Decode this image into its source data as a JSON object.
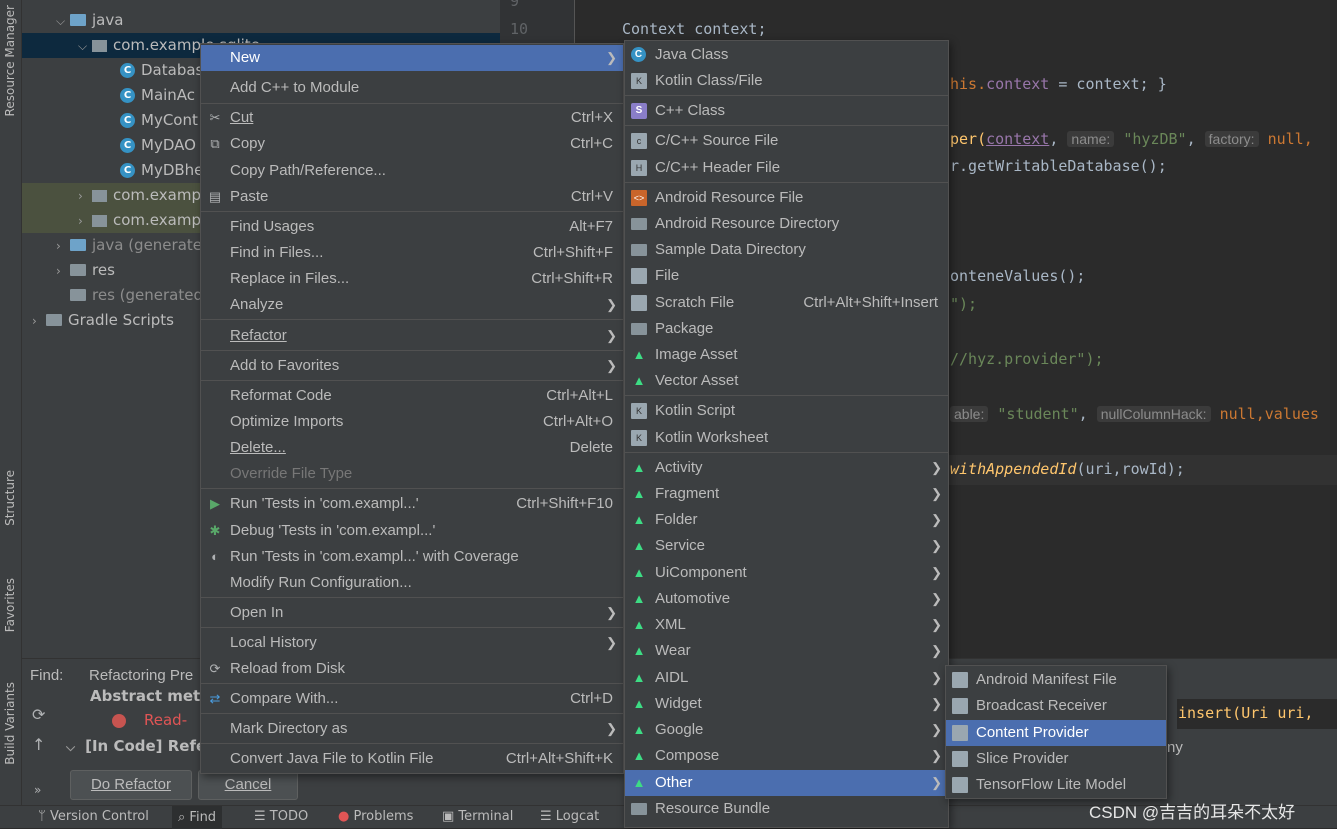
{
  "sidebar": {
    "resource_manager": "Resource Manager",
    "structure": "Structure",
    "favorites": "Favorites",
    "build_variants": "Build Variants"
  },
  "tree": {
    "java": "java",
    "pkg_main": "com.example.sqlite",
    "classes": [
      "Databas",
      "MainAc",
      "MyCont",
      "MyDAO",
      "MyDBhe"
    ],
    "pkg_androidtest": "com.examp",
    "pkg_test": "com.examp",
    "java_generated": "java (generated)",
    "res": "res",
    "res_generated": "res (generated)",
    "gradle_scripts": "Gradle Scripts"
  },
  "gutter": {
    "line9": "9",
    "line10": "10"
  },
  "code": {
    "l1": "Context context;",
    "l2a": "his.",
    "l2b": "context",
    "l2c": " = context; }",
    "l3a": "per(",
    "l3b": "context",
    "l3c": ",",
    "l3hint1": "name:",
    "l3str": "\"hyzDB\"",
    "l3hint2": "factory:",
    "l3d": "null,",
    "l4": "r.getWritableDatabase();",
    "l5": "onteneValues();",
    "l6": "\");",
    "l7": "//hyz.provider\");",
    "l8hint1": "able:",
    "l8str": "\"student\"",
    "l8hint2": "nullColumnHack:",
    "l8d": "null,values",
    "l9a": "withAppendedId",
    "l9b": "(uri,rowId);",
    "find_code": "insert(Uri uri,",
    "find_code2": "ny"
  },
  "find": {
    "label": "Find:",
    "tab": "Refactoring Pre",
    "row1": "Abstract metho",
    "row2": "Read-",
    "row3": "[In Code] Refe",
    "do_refactor": "Do Refactor",
    "cancel": "Cancel"
  },
  "bottom_bar": {
    "version_control": "Version Control",
    "find": "Find",
    "todo": "TODO",
    "problems": "Problems",
    "terminal": "Terminal",
    "logcat": "Logcat"
  },
  "context_menu": {
    "new": "New",
    "add_cpp": "Add C++ to Module",
    "cut": "Cut",
    "cut_sc": "Ctrl+X",
    "copy": "Copy",
    "copy_sc": "Ctrl+C",
    "copy_path": "Copy Path/Reference...",
    "paste": "Paste",
    "paste_sc": "Ctrl+V",
    "find_usages": "Find Usages",
    "find_usages_sc": "Alt+F7",
    "find_in_files": "Find in Files...",
    "find_in_files_sc": "Ctrl+Shift+F",
    "replace_in_files": "Replace in Files...",
    "replace_in_files_sc": "Ctrl+Shift+R",
    "analyze": "Analyze",
    "refactor": "Refactor",
    "add_to_favorites": "Add to Favorites",
    "reformat": "Reformat Code",
    "reformat_sc": "Ctrl+Alt+L",
    "optimize": "Optimize Imports",
    "optimize_sc": "Ctrl+Alt+O",
    "delete": "Delete...",
    "delete_sc": "Delete",
    "override": "Override File Type",
    "run": "Run 'Tests in 'com.exampl...'",
    "run_sc": "Ctrl+Shift+F10",
    "debug": "Debug 'Tests in 'com.exampl...'",
    "coverage": "Run 'Tests in 'com.exampl...' with Coverage",
    "modify_run": "Modify Run Configuration...",
    "open_in": "Open In",
    "local_history": "Local History",
    "reload": "Reload from Disk",
    "compare": "Compare With...",
    "compare_sc": "Ctrl+D",
    "mark_dir": "Mark Directory as",
    "convert": "Convert Java File to Kotlin File",
    "convert_sc": "Ctrl+Alt+Shift+K"
  },
  "new_menu": {
    "java_class": "Java Class",
    "kotlin_class": "Kotlin Class/File",
    "cpp_class": "C++ Class",
    "cpp_source": "C/C++ Source File",
    "cpp_header": "C/C++ Header File",
    "android_resource_file": "Android Resource File",
    "android_resource_dir": "Android Resource Directory",
    "sample_data_dir": "Sample Data Directory",
    "file": "File",
    "scratch": "Scratch File",
    "scratch_sc": "Ctrl+Alt+Shift+Insert",
    "package": "Package",
    "image_asset": "Image Asset",
    "vector_asset": "Vector Asset",
    "kotlin_script": "Kotlin Script",
    "kotlin_worksheet": "Kotlin Worksheet",
    "activity": "Activity",
    "fragment": "Fragment",
    "folder": "Folder",
    "service": "Service",
    "uicomponent": "UiComponent",
    "automotive": "Automotive",
    "xml": "XML",
    "wear": "Wear",
    "aidl": "AIDL",
    "widget": "Widget",
    "google": "Google",
    "compose": "Compose",
    "other": "Other",
    "resource_bundle": "Resource Bundle"
  },
  "other_menu": {
    "manifest": "Android Manifest File",
    "broadcast": "Broadcast Receiver",
    "content_provider": "Content Provider",
    "slice_provider": "Slice Provider",
    "tflite": "TensorFlow Lite Model"
  },
  "watermark": "CSDN @吉吉的耳朵不太好",
  "colors": {
    "highlight": "#4b6eaf",
    "menu_bg": "#3c3f41",
    "android_green": "#3ddc84",
    "editor_bg": "#2b2b2b"
  }
}
